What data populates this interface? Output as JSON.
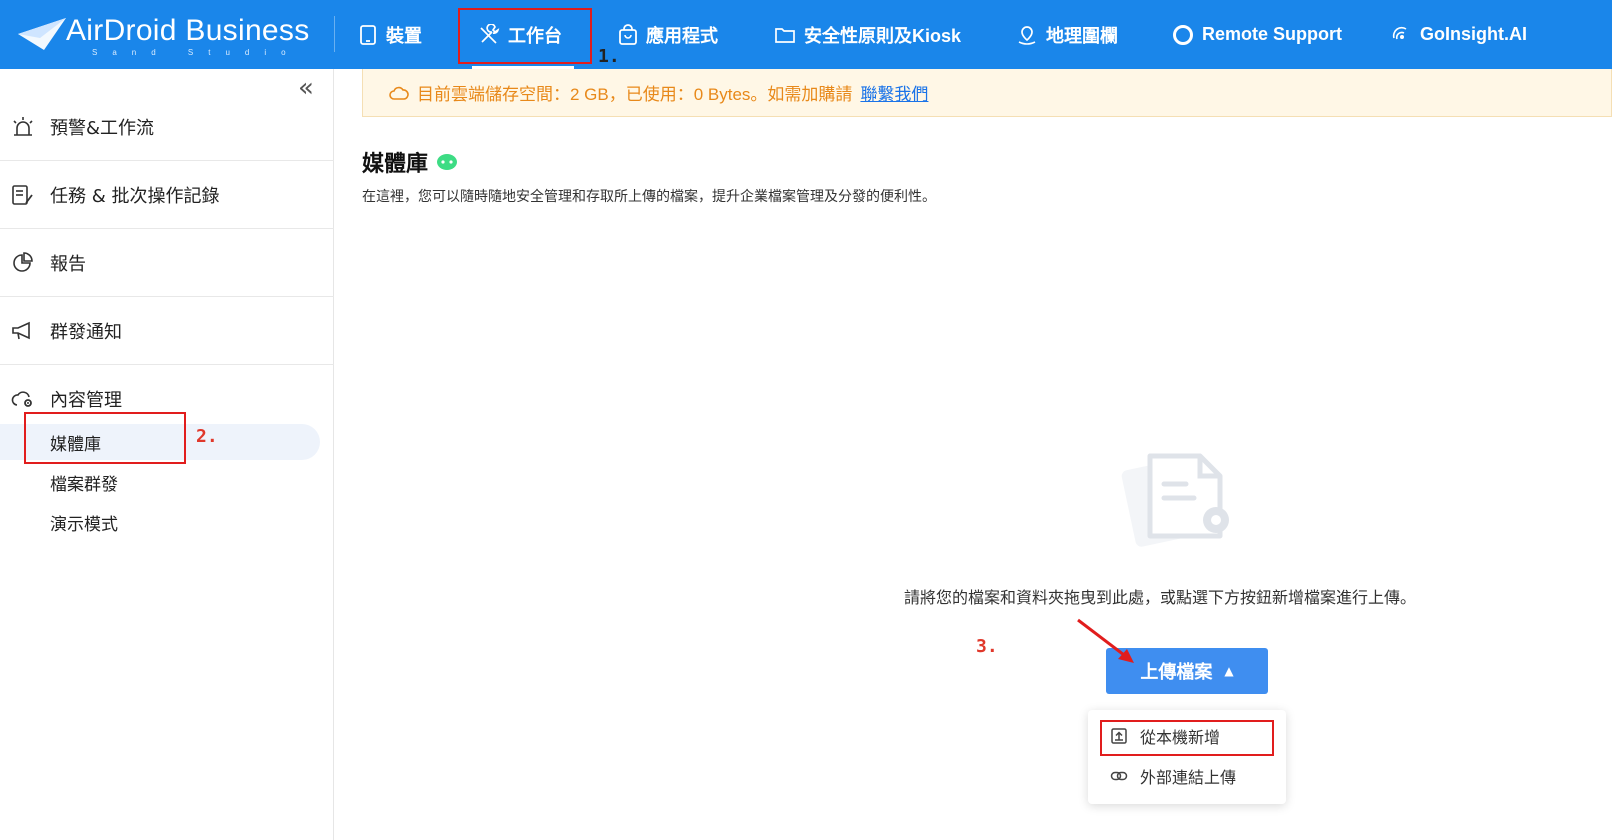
{
  "brand": {
    "name": "AirDroid Business",
    "sub": "Sand Studio"
  },
  "nav": [
    {
      "key": "devices",
      "label": "裝置",
      "icon": "tablet-icon"
    },
    {
      "key": "workbench",
      "label": "工作台",
      "icon": "tools-icon",
      "active": true
    },
    {
      "key": "apps",
      "label": "應用程式",
      "icon": "shopping-bag-icon"
    },
    {
      "key": "policy",
      "label": "安全性原則及Kiosk",
      "icon": "folder-icon"
    },
    {
      "key": "geofence",
      "label": "地理圍欄",
      "icon": "map-pin-icon"
    },
    {
      "key": "remote",
      "label": "Remote Support",
      "icon": "lifebuoy-icon"
    },
    {
      "key": "goinsight",
      "label": "GoInsight.AI",
      "icon": "ai-signal-icon"
    }
  ],
  "sidebar": {
    "collapse_glyph": "«",
    "groups": [
      {
        "label": "預警&工作流",
        "icon": "alarm-icon"
      },
      {
        "label": "任務 & 批次操作記錄",
        "icon": "task-log-icon"
      },
      {
        "label": "報告",
        "icon": "pie-chart-icon"
      },
      {
        "label": "群發通知",
        "icon": "megaphone-icon"
      },
      {
        "label": "內容管理",
        "icon": "cloud-gear-icon"
      }
    ],
    "sub_items": [
      {
        "label": "媒體庫",
        "active": true
      },
      {
        "label": "檔案群發"
      },
      {
        "label": "演示模式"
      }
    ]
  },
  "notice": {
    "text": "目前雲端儲存空間：2 GB，已使用：0 Bytes。如需加購請",
    "link": "聯繫我們",
    "icon": "cloud-icon"
  },
  "page": {
    "title": "媒體庫",
    "title_badge_icon": "android-icon",
    "description": "在這裡，您可以隨時隨地安全管理和存取所上傳的檔案，提升企業檔案管理及分發的便利性。"
  },
  "empty_state": {
    "icon": "document-gear-icon",
    "text": "請將您的檔案和資料夾拖曳到此處，或點選下方按鈕新增檔案進行上傳。"
  },
  "upload": {
    "label": "上傳檔案",
    "caret": "▲",
    "menu": [
      {
        "label": "從本機新增",
        "icon": "upload-box-icon"
      },
      {
        "label": "外部連結上傳",
        "icon": "link-icon"
      }
    ]
  },
  "annotations": {
    "step1": "1.",
    "step2": "2.",
    "step3": "3.",
    "highlight_color": "#e11d1d"
  },
  "colors": {
    "topbar": "#1a86ea",
    "primary_button": "#3f8ef0",
    "notice_bg": "#fff7e6",
    "notice_text": "#e8891a",
    "android_green": "#3ddc84"
  }
}
